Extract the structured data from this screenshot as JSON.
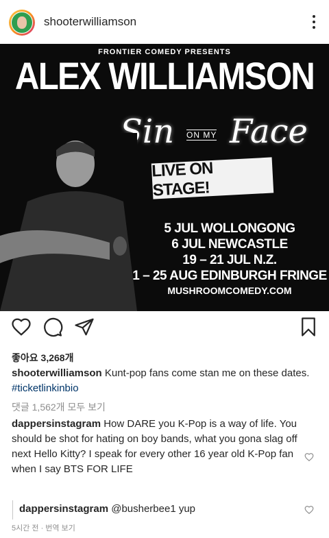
{
  "header": {
    "username": "shooterwilliamson"
  },
  "poster": {
    "presents": "FRONTIER COMEDY PRESENTS",
    "title": "ALEX WILLIAMSON",
    "script_left": "Sin",
    "script_small": "ON MY",
    "script_right": "Face",
    "live": "LIVE ON STAGE!",
    "dates": [
      "5 JUL WOLLONGONG",
      "6 JUL NEWCASTLE",
      "19 – 21 JUL N.Z.",
      "1 – 25 AUG EDINBURGH FRINGE"
    ],
    "site": "MUSHROOMCOMEDY.COM"
  },
  "likes": "좋아요 3,268개",
  "caption": {
    "user": "shooterwilliamson",
    "text": " Kunt-pop fans come stan me on these dates. ",
    "hashtag": "#ticketlinkinbio"
  },
  "view_all": "댓글 1,562개 모두 보기",
  "comments": [
    {
      "user": "dappersinstagram",
      "text": " How DARE you K-Pop is a way of life. You should be shot for hating on boy bands, what you gona slag off next Hello Kitty? I speak for every other 16 year old K-Pop fan when I say BTS FOR LIFE"
    }
  ],
  "reply": {
    "user": "dappersinstagram",
    "text": " @busherbee1 yup"
  },
  "footer": {
    "time": "5시간 전 · 번역 보기"
  }
}
